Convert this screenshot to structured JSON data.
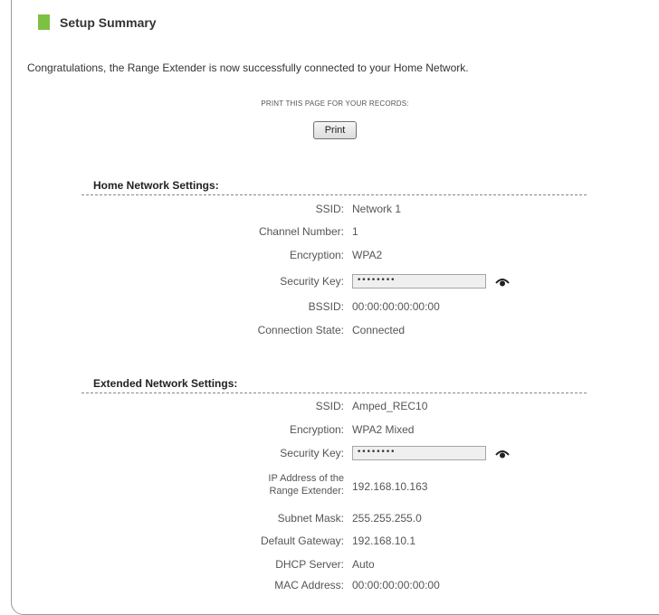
{
  "header": {
    "title": "Setup Summary"
  },
  "message": "Congratulations, the Range Extender is now successfully connected to your Home Network.",
  "print": {
    "note": "PRINT THIS PAGE FOR YOUR RECORDS:",
    "button_label": "Print"
  },
  "home_network": {
    "title": "Home Network Settings:",
    "ssid_label": "SSID:",
    "ssid": "Network 1",
    "channel_label": "Channel Number:",
    "channel": "1",
    "encryption_label": "Encryption:",
    "encryption": "WPA2",
    "security_key_label": "Security Key:",
    "security_key": "••••••••",
    "bssid_label": "BSSID:",
    "bssid": "00:00:00:00:00:00",
    "state_label": "Connection State:",
    "state": "Connected"
  },
  "extended_network": {
    "title": "Extended Network Settings:",
    "ssid_label": "SSID:",
    "ssid": "Amped_REC10",
    "encryption_label": "Encryption:",
    "encryption": "WPA2 Mixed",
    "security_key_label": "Security Key:",
    "security_key": "••••••••",
    "ip_label_line1": "IP Address of the",
    "ip_label_line2": "Range Extender:",
    "ip": "192.168.10.163",
    "subnet_label": "Subnet Mask:",
    "subnet": "255.255.255.0",
    "gateway_label": "Default Gateway:",
    "gateway": "192.168.10.1",
    "dhcp_label": "DHCP Server:",
    "dhcp": "Auto",
    "mac_label": "MAC Address:",
    "mac": "00:00:00:00:00:00"
  },
  "icons": {
    "title_marker_color": "#7dc142",
    "reveal": "eye-icon"
  }
}
